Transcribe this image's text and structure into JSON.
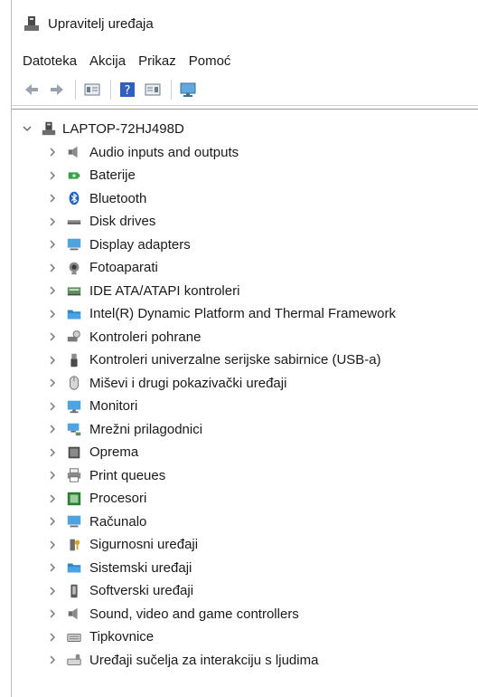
{
  "window": {
    "title": "Upravitelj uređaja"
  },
  "menu": {
    "items": [
      "Datoteka",
      "Akcija",
      "Prikaz",
      "Pomoć"
    ]
  },
  "toolbar": {
    "buttons": [
      "back-icon",
      "forward-icon",
      "properties-icon",
      "help-icon",
      "update-driver-icon",
      "monitor-icon"
    ]
  },
  "tree": {
    "root_label": "LAPTOP-72HJ498D",
    "items": [
      {
        "label": "Audio inputs and outputs",
        "icon": "speaker-icon"
      },
      {
        "label": "Baterije",
        "icon": "battery-icon"
      },
      {
        "label": "Bluetooth",
        "icon": "bluetooth-icon"
      },
      {
        "label": "Disk drives",
        "icon": "disk-drive-icon"
      },
      {
        "label": "Display adapters",
        "icon": "display-adapter-icon"
      },
      {
        "label": "Fotoaparati",
        "icon": "camera-icon"
      },
      {
        "label": "IDE ATA/ATAPI kontroleri",
        "icon": "ide-controller-icon"
      },
      {
        "label": "Intel(R) Dynamic Platform and Thermal Framework",
        "icon": "folder-icon"
      },
      {
        "label": "Kontroleri pohrane",
        "icon": "storage-controller-icon"
      },
      {
        "label": "Kontroleri univerzalne serijske sabirnice (USB-a)",
        "icon": "usb-icon"
      },
      {
        "label": "Miševi i drugi pokazivački uređaji",
        "icon": "mouse-icon"
      },
      {
        "label": "Monitori",
        "icon": "monitor-icon"
      },
      {
        "label": "Mrežni prilagodnici",
        "icon": "network-icon"
      },
      {
        "label": "Oprema",
        "icon": "firmware-icon"
      },
      {
        "label": "Print queues",
        "icon": "printer-icon"
      },
      {
        "label": "Procesori",
        "icon": "processor-icon"
      },
      {
        "label": "Računalo",
        "icon": "computer-icon"
      },
      {
        "label": "Sigurnosni uređaji",
        "icon": "security-key-icon"
      },
      {
        "label": "Sistemski uređaji",
        "icon": "folder-icon"
      },
      {
        "label": "Softverski uređaji",
        "icon": "software-device-icon"
      },
      {
        "label": "Sound, video and game controllers",
        "icon": "speaker-icon"
      },
      {
        "label": "Tipkovnice",
        "icon": "keyboard-icon"
      },
      {
        "label": "Uređaji sučelja za interakciju s ljudima",
        "icon": "hid-icon"
      }
    ]
  }
}
